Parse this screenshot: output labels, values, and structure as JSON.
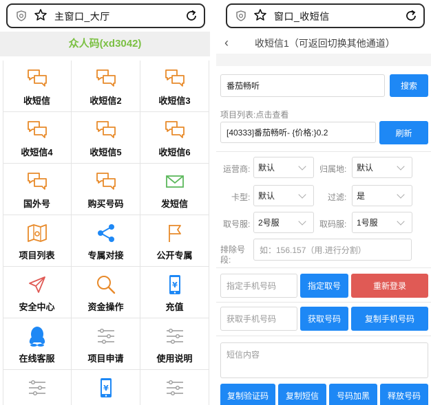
{
  "left": {
    "url_text": "主窗口_大厅",
    "header": "众人码(xd3042)",
    "header_color": "#7bc043",
    "grid": [
      {
        "label": "收短信",
        "icon": "chat-icon"
      },
      {
        "label": "收短信2",
        "icon": "chat-icon"
      },
      {
        "label": "收短信3",
        "icon": "chat-icon"
      },
      {
        "label": "收短信4",
        "icon": "chat-icon"
      },
      {
        "label": "收短信5",
        "icon": "chat-icon"
      },
      {
        "label": "收短信6",
        "icon": "chat-icon"
      },
      {
        "label": "国外号",
        "icon": "chat-icon"
      },
      {
        "label": "购买号码",
        "icon": "chat-icon"
      },
      {
        "label": "发短信",
        "icon": "envelope-icon"
      },
      {
        "label": "项目列表",
        "icon": "map-icon"
      },
      {
        "label": "专属对接",
        "icon": "share-icon"
      },
      {
        "label": "公开专属",
        "icon": "flag-icon"
      },
      {
        "label": "安全中心",
        "icon": "send-icon"
      },
      {
        "label": "资金操作",
        "icon": "search-icon"
      },
      {
        "label": "充值",
        "icon": "phone-yen-icon"
      },
      {
        "label": "在线客服",
        "icon": "qq-icon"
      },
      {
        "label": "项目申请",
        "icon": "sliders-icon"
      },
      {
        "label": "使用说明",
        "icon": "sliders-icon"
      },
      {
        "label": "",
        "icon": "sliders-icon"
      },
      {
        "label": "",
        "icon": "phone-yen-icon"
      },
      {
        "label": "",
        "icon": "sliders-icon"
      }
    ]
  },
  "right": {
    "url_text": "窗口_收短信",
    "title": "收短信1（可返回切换其他通道）",
    "search_value": "番茄畅听",
    "search_button": "搜索",
    "project_list_label": "项目列表:点击查看",
    "project_value": "[40333]番茄畅听- {价格:}0.2",
    "refresh_button": "刷新",
    "carrier_label": "运营商:",
    "carrier_value": "默认",
    "region_label": "归属地:",
    "region_value": "默认",
    "cardtype_label": "卡型:",
    "cardtype_value": "默认",
    "filter_label": "过滤:",
    "filter_value": "是",
    "take_server_label": "取号服:",
    "take_server_value": "2号服",
    "code_server_label": "取码服:",
    "code_server_value": "1号服",
    "exclude_label_1": "排除号",
    "exclude_label_2": "段:",
    "exclude_placeholder": "如：156.157（用.进行分割）",
    "assign_phone_placeholder": "指定手机号码",
    "assign_button": "指定取号",
    "relogin_button": "重新登录",
    "get_phone_placeholder": "获取手机号码",
    "get_number_button": "获取号码",
    "copy_phone_button": "复制手机号码",
    "sms_placeholder": "短信内容",
    "copy_code_button": "复制验证码",
    "copy_sms_button": "复制短信",
    "blacklist_button": "号码加黑",
    "release_button": "释放号码",
    "primary_color": "#1e88f5",
    "danger_color": "#e05a55"
  }
}
